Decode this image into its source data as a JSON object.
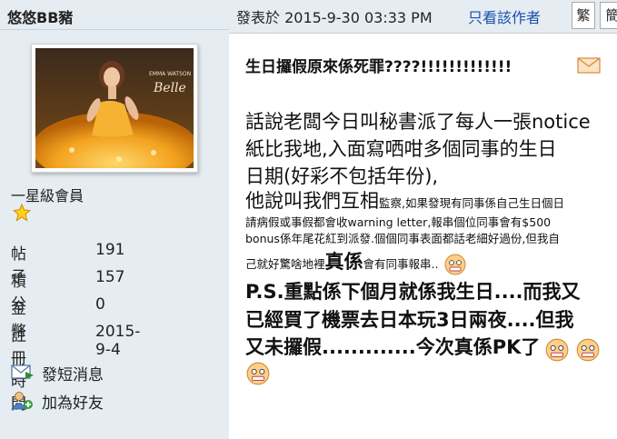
{
  "user": {
    "name": "悠悠BB豬",
    "avatar_caption_1": "EMMA WATSON",
    "avatar_caption_2": "Belle",
    "rank": "一星級會員"
  },
  "stats": [
    {
      "label": "帖子",
      "value": "191"
    },
    {
      "label": "積分",
      "value": "157"
    },
    {
      "label": "金幣",
      "value": "0"
    },
    {
      "label": "註冊時間",
      "value": "2015-9-4"
    }
  ],
  "actions": {
    "message": "發短消息",
    "add_friend": "加為好友"
  },
  "post_header": {
    "posted": "發表於 2015-9-30 03:33 PM",
    "author_only": "只看該作者",
    "traditional": "繁",
    "simplified": "簡"
  },
  "post": {
    "title": "生日攞假原來係死罪????!!!!!!!!!!!!!",
    "line1": "話說老闆今日叫秘書派了每人一張notice",
    "line2": "紙比我地,入面寫哂咁多個同事的生日",
    "line3": "日期(好彩不包括年份),",
    "line4a": "他說叫我們互相",
    "line4b": "監察,如果發現有同事係自己生日個日",
    "line5": "請病假或事假都會收warning letter,報串個位同事會有$500",
    "line6": "bonus係年尾花紅到派發.個個同事表面都話老細好過份,但我自",
    "line7a": "己就好驚啥地裡",
    "line7b": "真係",
    "line7c": "會有同事報串..",
    "line8": "P.S.重點係下個月就係我生日....而我又",
    "line9": "已經買了機票去日本玩3日兩夜....但我",
    "line10": "又未攞假.............今次真係PK了"
  }
}
